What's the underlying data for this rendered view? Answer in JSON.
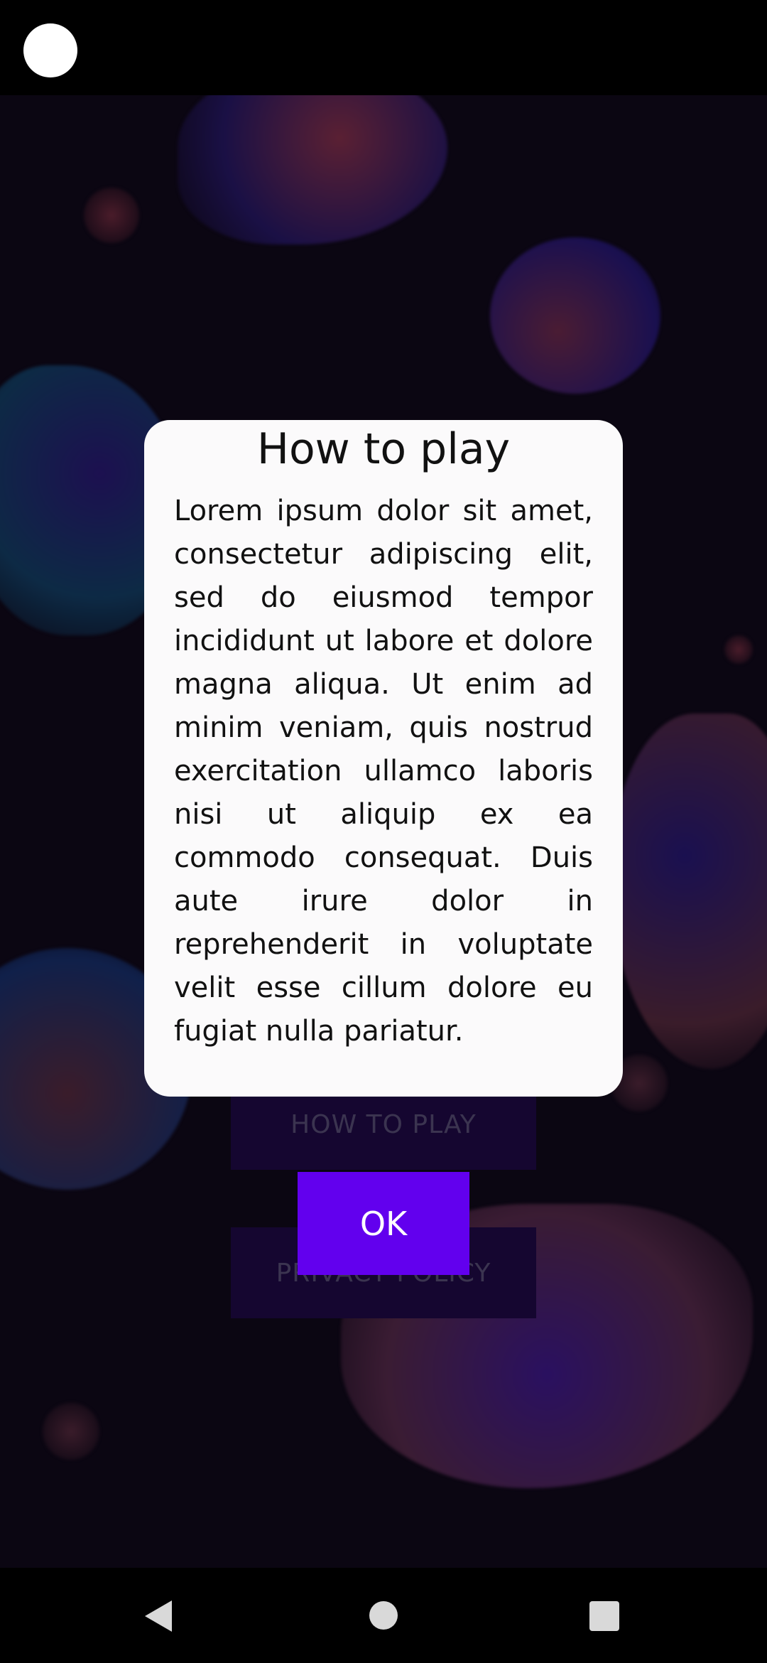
{
  "dialog": {
    "title": "How to play",
    "body": "Lorem ipsum dolor sit amet, consectetur adipiscing elit, sed do eiusmod tempor incididunt ut labore et dolore magna aliqua. Ut enim ad minim veniam, quis nostrud exercitation ullamco laboris nisi ut aliquip ex ea commodo consequat. Duis aute irure dolor in reprehenderit in voluptate velit esse cillum dolore eu fugiat nulla pariatur."
  },
  "menu": {
    "how_to_play_label": "HOW TO PLAY",
    "privacy_policy_label": "PRIVACY POLICY"
  },
  "ok_button": {
    "label": "OK"
  },
  "colors": {
    "accent": "#6200ee",
    "dialog_background": "#fbfafb",
    "screen_background": "#0b0612"
  },
  "navigation": {
    "back_icon": "back-triangle-icon",
    "home_icon": "home-circle-icon",
    "recents_icon": "recents-square-icon"
  }
}
